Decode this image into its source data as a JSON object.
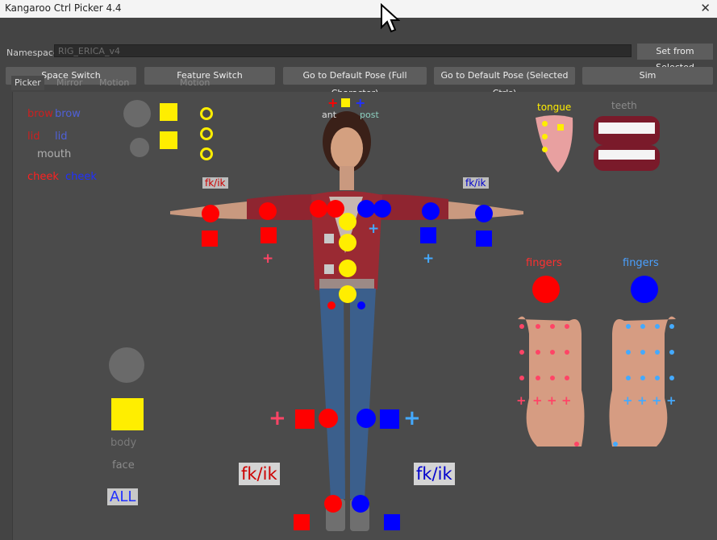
{
  "window": {
    "title": "Kangaroo Ctrl Picker 4.4",
    "close_label": "✕"
  },
  "namespace": {
    "label": "Namespace",
    "value": "RIG_ERICA_v4",
    "set_button": "Set from Selected"
  },
  "buttons": {
    "space_switch": "Space Switch",
    "feature_switch": "Feature Switch",
    "default_pose_full": "Go to Default Pose (Full Character)",
    "default_pose_selected": "Go to Default Pose (Selected Ctrls)",
    "sim": "Sim"
  },
  "tabs": [
    "Picker",
    "Mirror",
    "Motion Capture",
    "Motion Path"
  ],
  "active_tab": "Picker",
  "picker": {
    "face_labels": {
      "brow_l": "brow",
      "brow_r": "brow",
      "lid_l": "lid",
      "lid_r": "lid",
      "mouth": "mouth",
      "cheek_l": "cheek",
      "cheek_r": "cheek",
      "tongue": "tongue",
      "teeth": "teeth",
      "ant": "ant",
      "post": "post"
    },
    "fkik_small_left": "fk/ik",
    "fkik_small_right": "fk/ik",
    "fkik_big_left": "fk/ik",
    "fkik_big_right": "fk/ik",
    "fingers_left": "fingers",
    "fingers_right": "fingers",
    "body_label": "body",
    "face_label": "face",
    "all_label": "ALL",
    "colors": {
      "left": "#ff0000",
      "right": "#0000ff",
      "center": "#ffee00",
      "left_light": "#ff4466",
      "right_light": "#44aaff"
    }
  }
}
